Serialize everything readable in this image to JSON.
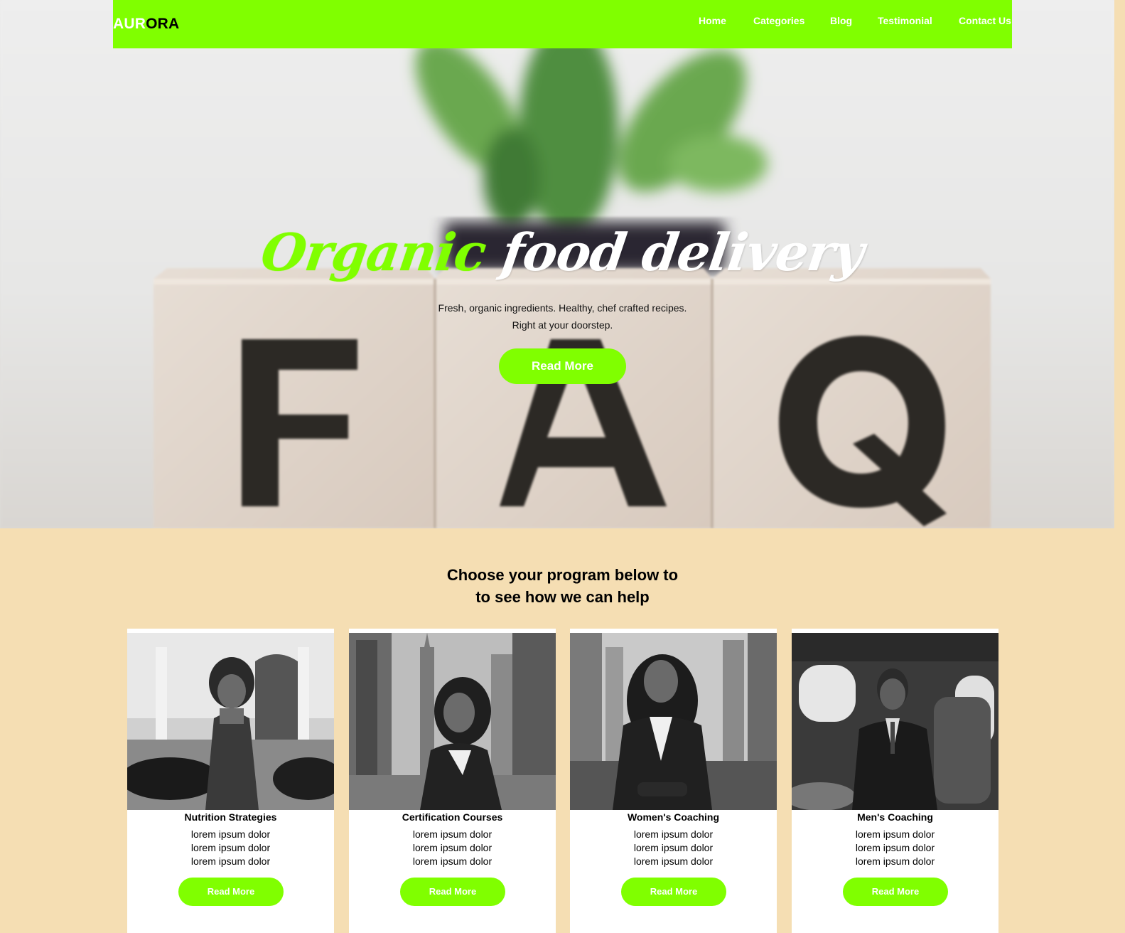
{
  "logo": {
    "part1": "AUR",
    "part2": "ORA"
  },
  "nav": {
    "home": "Home",
    "categories": "Categories",
    "blog": "Blog",
    "testimonial": "Testimonial",
    "contact": "Contact Us"
  },
  "hero": {
    "title_green": "Organic",
    "title_white": "food delivery",
    "subtitle_line1": "Fresh, organic ingredients. Healthy, chef crafted recipes.",
    "subtitle_line2": "Right at your doorstep.",
    "button": "Read More",
    "block_letters": [
      "F",
      "A",
      "Q"
    ]
  },
  "programs": {
    "heading_line1": "Choose your program below to",
    "heading_line2": "to see how we can help",
    "cards": [
      {
        "title": "Nutrition Strategies",
        "lines": [
          "lorem ipsum dolor",
          "lorem ipsum dolor",
          "lorem ipsum dolor"
        ],
        "button": "Read More"
      },
      {
        "title": "Certification Courses",
        "lines": [
          "lorem ipsum dolor",
          "lorem ipsum dolor",
          "lorem ipsum dolor"
        ],
        "button": "Read More"
      },
      {
        "title": "Women's Coaching",
        "lines": [
          "lorem ipsum dolor",
          "lorem ipsum dolor",
          "lorem ipsum dolor"
        ],
        "button": "Read More"
      },
      {
        "title": "Men's Coaching",
        "lines": [
          "lorem ipsum dolor",
          "lorem ipsum dolor",
          "lorem ipsum dolor"
        ],
        "button": "Read More"
      }
    ]
  },
  "colors": {
    "accent": "#80ff00",
    "section_bg": "#f5deb3",
    "card_bg": "#ffffff"
  }
}
